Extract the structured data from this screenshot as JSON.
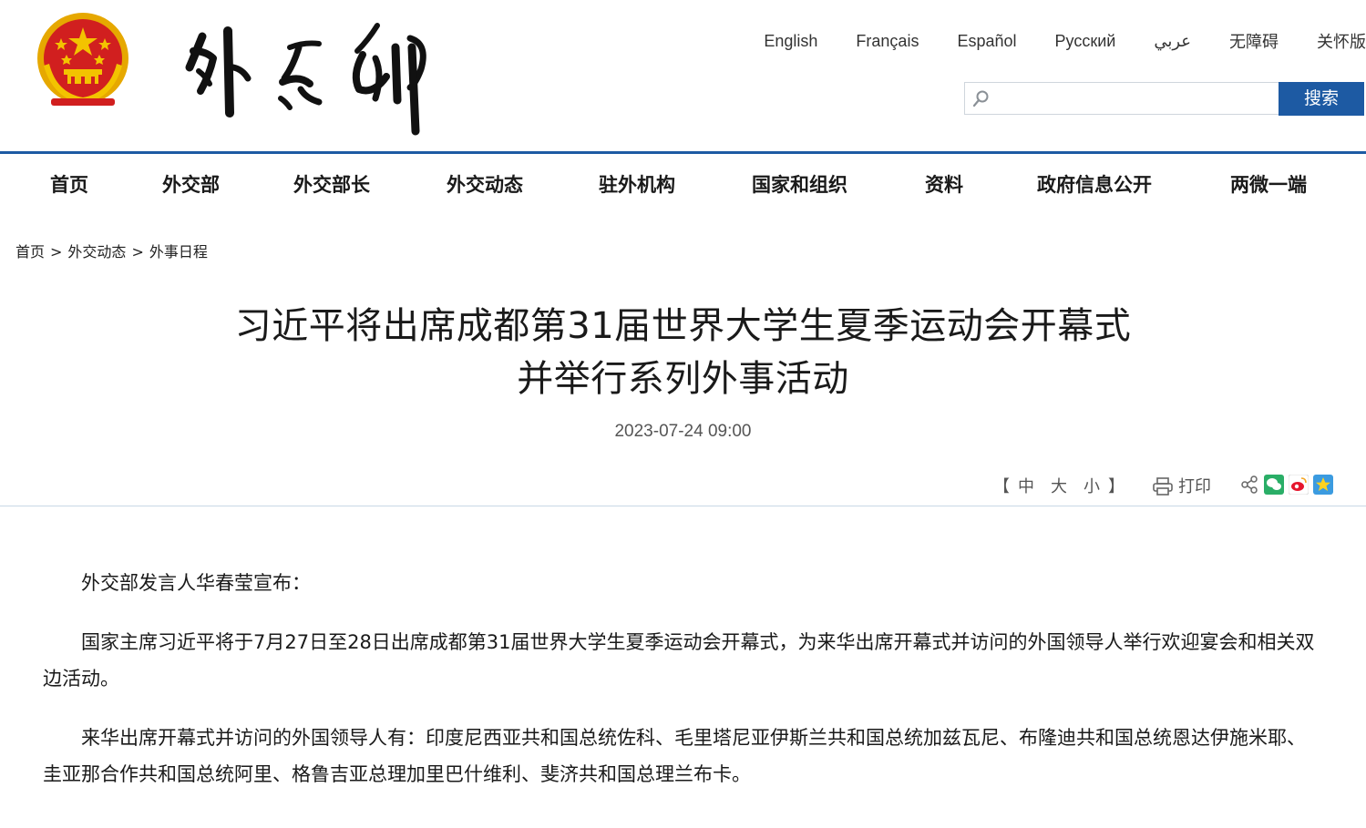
{
  "header": {
    "languages": [
      "English",
      "Français",
      "Español",
      "Русский",
      "عربي",
      "无障碍",
      "关怀版"
    ],
    "search": {
      "placeholder": "",
      "button_label": "搜索"
    }
  },
  "nav": {
    "items": [
      "首页",
      "外交部",
      "外交部长",
      "外交动态",
      "驻外机构",
      "国家和组织",
      "资料",
      "政府信息公开",
      "两微一端"
    ]
  },
  "breadcrumb": {
    "items": [
      "首页",
      "外交动态",
      "外事日程"
    ],
    "separator": ">"
  },
  "article": {
    "title_line1": "习近平将出席成都第31届世界大学生夏季运动会开幕式",
    "title_line2": "并举行系列外事活动",
    "date": "2023-07-24 09:00",
    "tools": {
      "bracket_open": "【",
      "font_sizes": [
        "中",
        "大",
        "小"
      ],
      "bracket_close": "】",
      "print_label": "打印"
    },
    "paragraphs": [
      "外交部发言人华春莹宣布：",
      "国家主席习近平将于7月27日至28日出席成都第31届世界大学生夏季运动会开幕式，为来华出席开幕式并访问的外国领导人举行欢迎宴会和相关双边活动。",
      "来华出席开幕式并访问的外国领导人有：印度尼西亚共和国总统佐科、毛里塔尼亚伊斯兰共和国总统加兹瓦尼、布隆迪共和国总统恩达伊施米耶、圭亚那合作共和国总统阿里、格鲁吉亚总理加里巴什维利、斐济共和国总理兰布卡。"
    ]
  },
  "icons": {
    "emblem": "national-emblem-icon",
    "search": "search-icon",
    "print": "printer-icon",
    "share": "share-icon",
    "wechat": "wechat-icon",
    "weibo": "weibo-icon",
    "qzone": "qzone-star-icon"
  },
  "colors": {
    "accent": "#1d5aa3",
    "emblem_red": "#d11f1f",
    "emblem_gold": "#f3c300"
  }
}
